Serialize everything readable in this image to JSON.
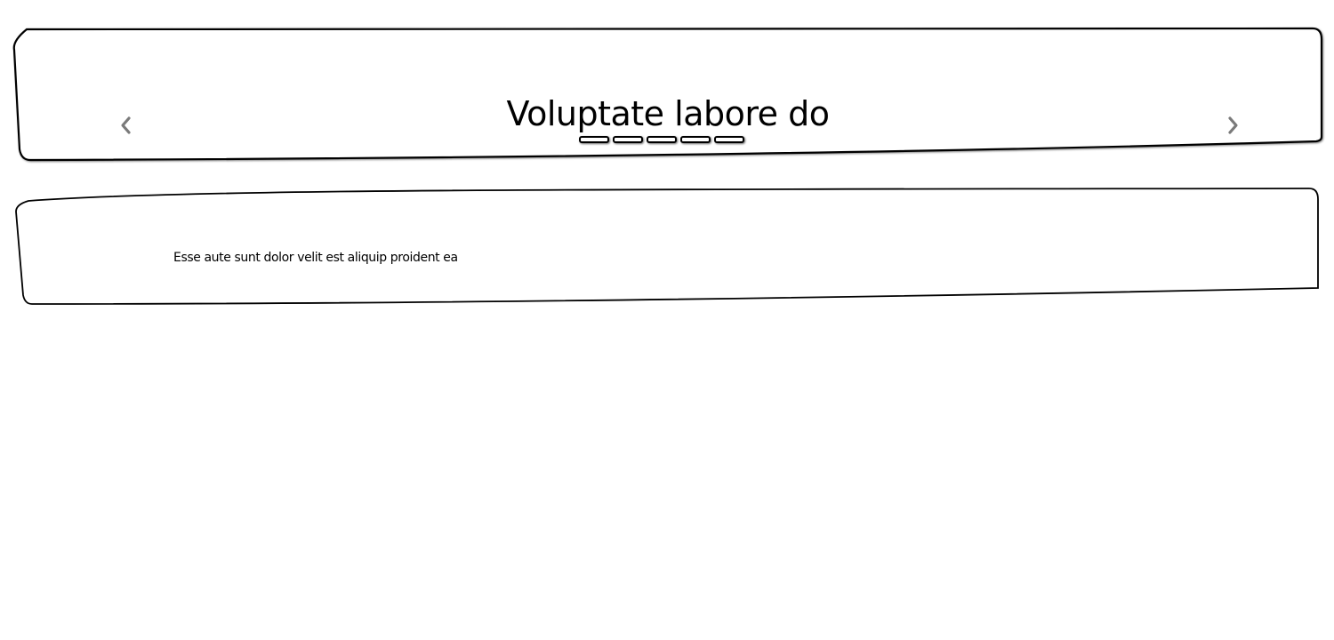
{
  "carousel": {
    "title": "Voluptate labore do",
    "prev_icon": "chevron-left-icon",
    "next_icon": "chevron-right-icon",
    "indicator_count": 5
  },
  "card": {
    "text": "Esse aute sunt dolor velit est aliquip proident ea"
  },
  "colors": {
    "outline": "#000000",
    "arrow": "#7a7a7a",
    "background": "#ffffff"
  }
}
